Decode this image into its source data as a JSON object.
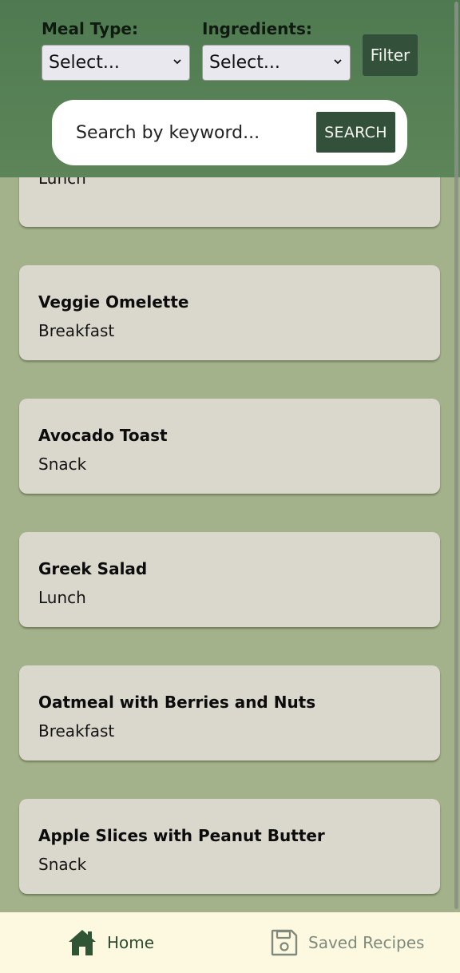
{
  "filters": {
    "meal_type_label": "Meal Type:",
    "meal_type_selected": "Select...",
    "ingredients_label": "Ingredients:",
    "ingredients_selected": "Select...",
    "filter_button": "Filter"
  },
  "search": {
    "placeholder": "Search by keyword...",
    "button": "SEARCH"
  },
  "recipes": [
    {
      "title": "",
      "meal": "Lunch"
    },
    {
      "title": "Veggie Omelette",
      "meal": "Breakfast"
    },
    {
      "title": "Avocado Toast",
      "meal": "Snack"
    },
    {
      "title": "Greek Salad",
      "meal": "Lunch"
    },
    {
      "title": "Oatmeal with Berries and Nuts",
      "meal": "Breakfast"
    },
    {
      "title": "Apple Slices with Peanut Butter",
      "meal": "Snack"
    }
  ],
  "nav": {
    "home_label": "Home",
    "home_icon": "home-icon",
    "saved_label": "Saved Recipes",
    "saved_icon": "save-icon"
  },
  "colors": {
    "header_bg": "#5a8257",
    "page_bg": "#a3b28a",
    "card_bg": "#dad8cd",
    "button_bg": "#33503a",
    "nav_bg": "#fdf9e1"
  }
}
